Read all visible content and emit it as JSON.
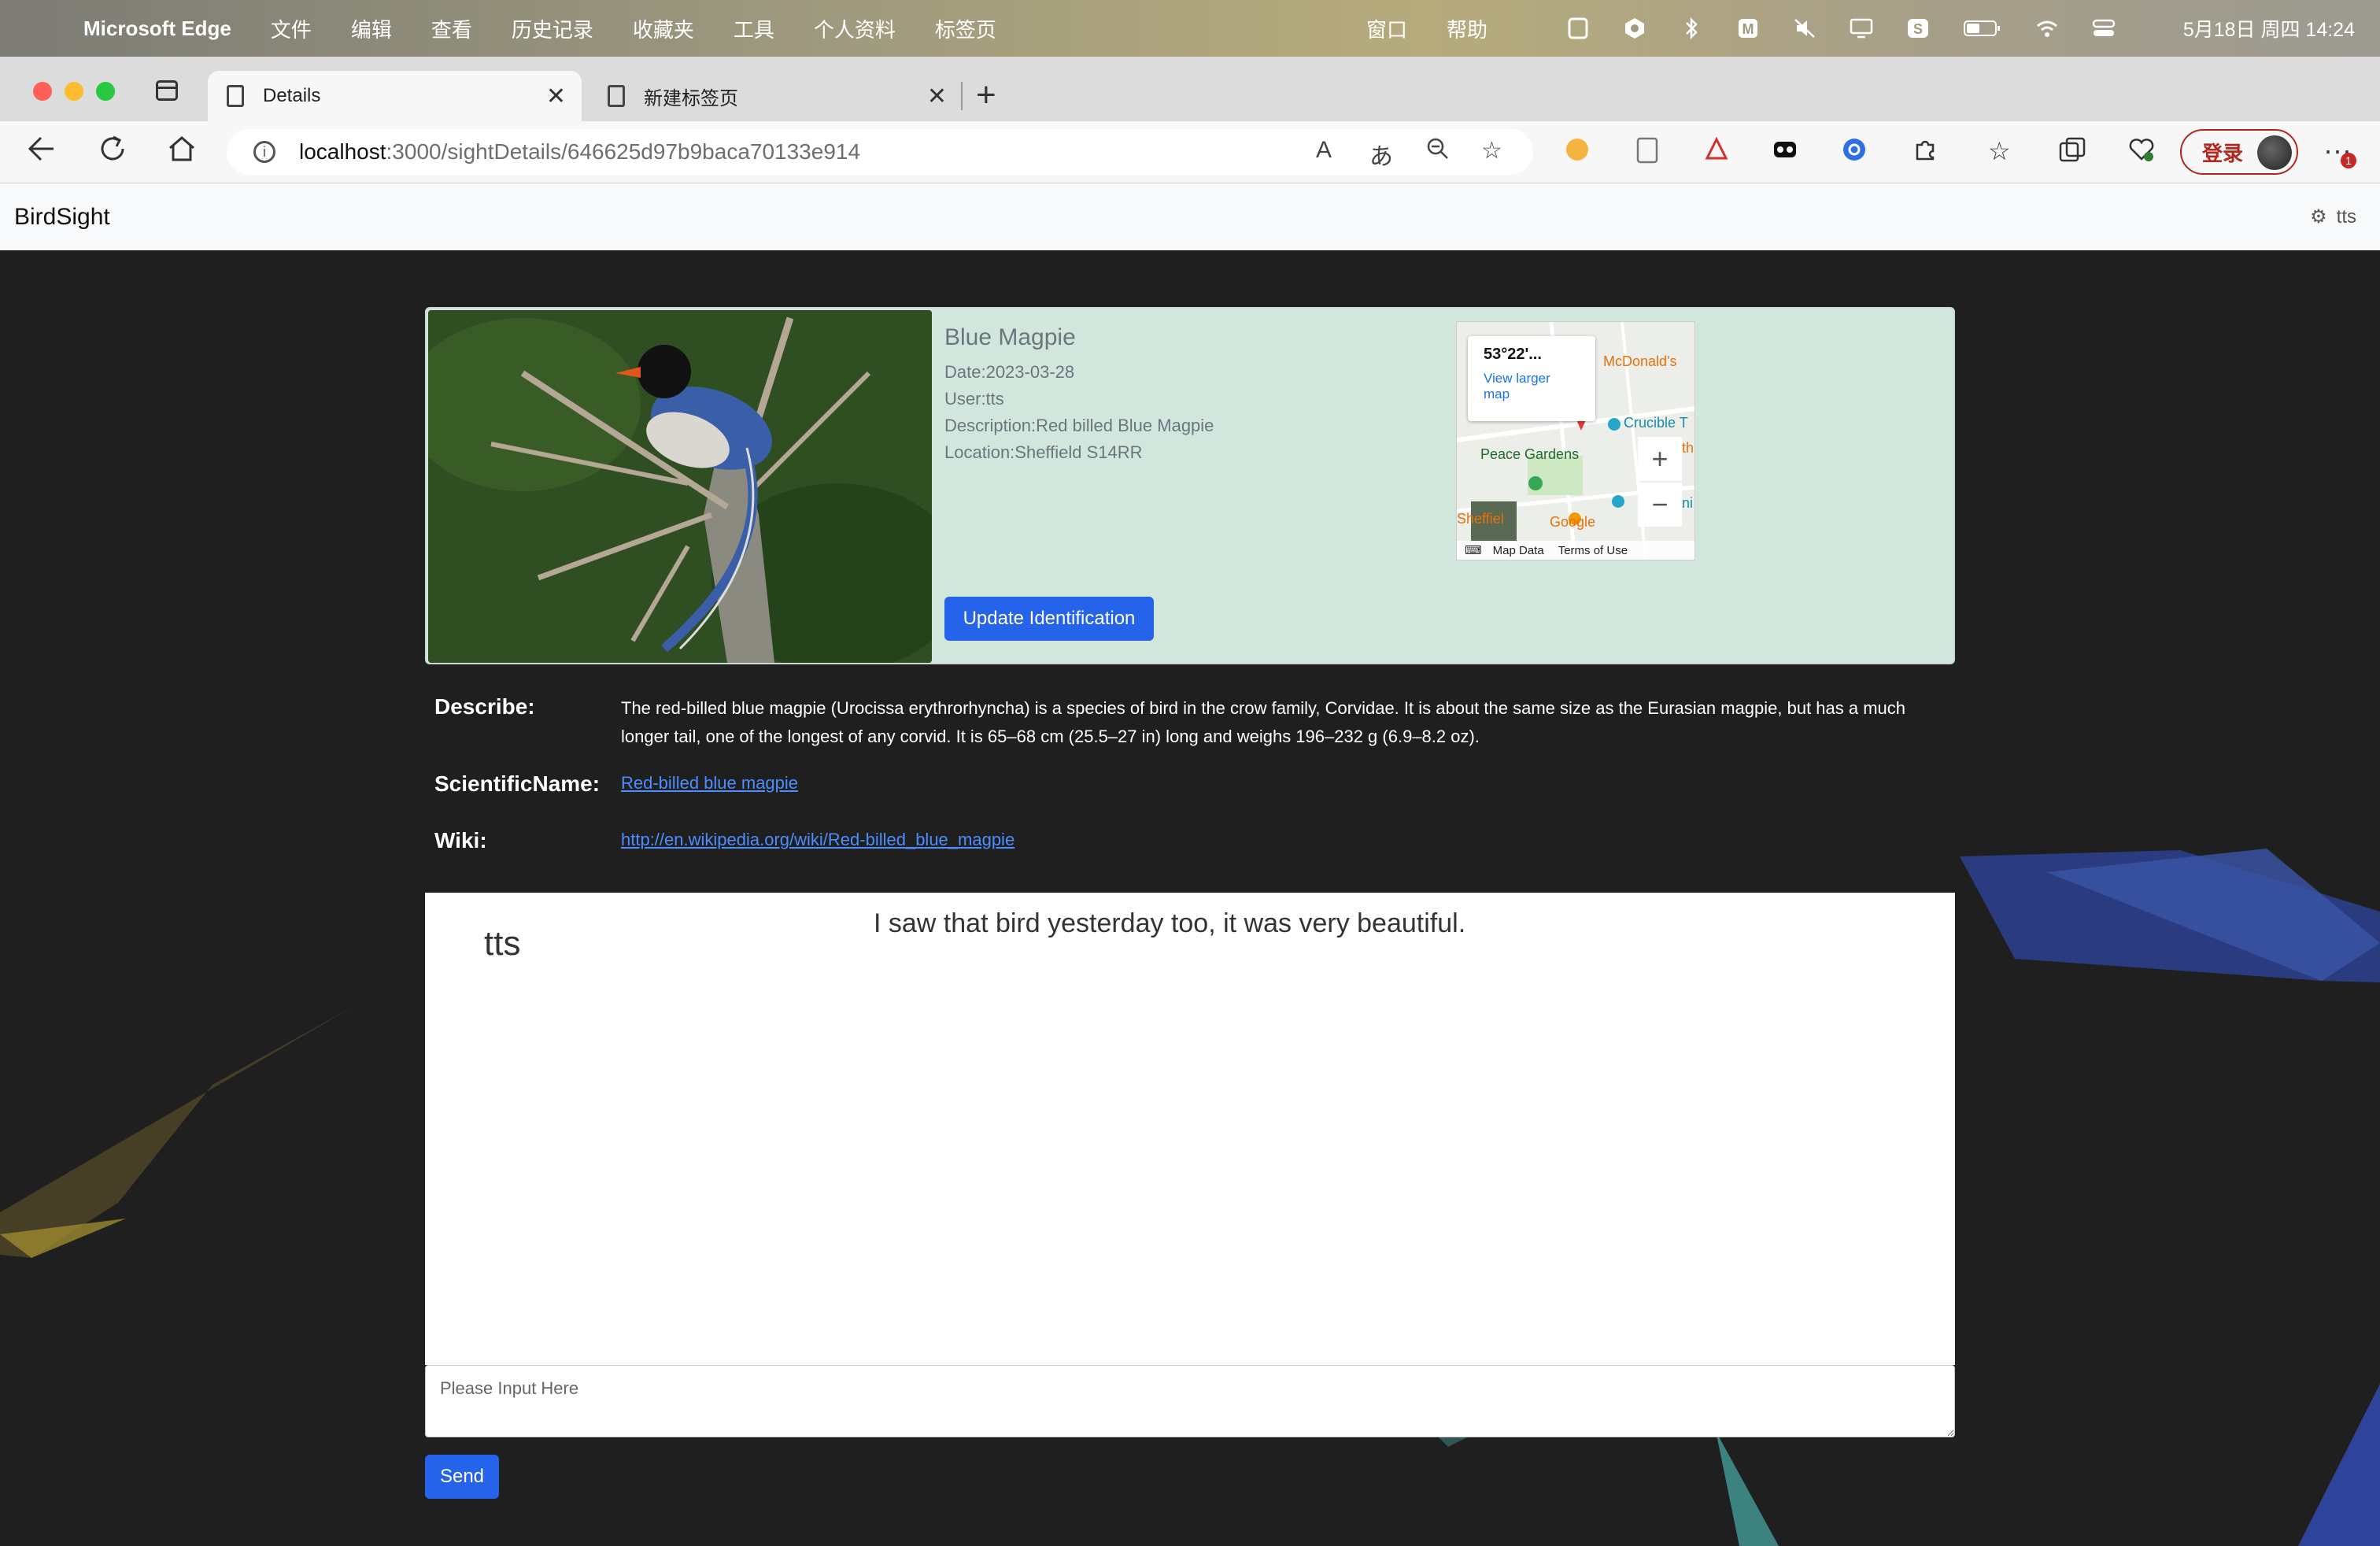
{
  "menubar": {
    "app_name": "Microsoft Edge",
    "menus": [
      "文件",
      "编辑",
      "查看",
      "历史记录",
      "收藏夹",
      "工具",
      "个人资料",
      "标签页"
    ],
    "right_menus": [
      "窗口",
      "帮助"
    ],
    "clock": "5月18日 周四  14:24"
  },
  "tabs": [
    {
      "title": "Details"
    },
    {
      "title": "新建标签页"
    }
  ],
  "address": {
    "host": "localhost",
    "path": ":3000/sightDetails/646625d97b9baca70133e914"
  },
  "toolbar": {
    "login_label": "登录",
    "more_badge": "1"
  },
  "navbar": {
    "brand": "BirdSight",
    "user": "tts"
  },
  "sighting": {
    "title": "Blue Magpie",
    "date": "Date:2023-03-28",
    "user": "User:tts",
    "description": "Description:Red billed Blue Magpie",
    "location": "Location:Sheffield S14RR",
    "update_button": "Update Identification"
  },
  "map": {
    "coords": "53°22'...",
    "view_larger": "View larger map",
    "labels": {
      "mcdonalds": "McDonald's",
      "crucible": "Crucible T",
      "peace_gardens": "Peace Gardens",
      "sheffield": "Sheffiel",
      "google": "Google",
      "edge_th": "th",
      "edge_ni": "ni"
    },
    "map_data": "Map Data",
    "terms": "Terms of Use",
    "zoom_in": "+",
    "zoom_out": "−"
  },
  "details": {
    "describe_label": "Describe:",
    "describe_text": "The red-billed blue magpie (Urocissa erythrorhyncha) is a species of bird in the crow family, Corvidae. It is about the same size as the Eurasian magpie, but has a much longer tail, one of the longest of any corvid. It is 65–68 cm (25.5–27 in) long and weighs 196–232 g (6.9–8.2 oz).",
    "scientific_label": "ScientificName:",
    "scientific_link": "Red-billed blue magpie",
    "wiki_label": "Wiki:",
    "wiki_link": "http://en.wikipedia.org/wiki/Red-billed_blue_magpie"
  },
  "chat": {
    "username": "tts",
    "message": "I saw that bird yesterday too, it was very beautiful.",
    "input_placeholder": "Please Input Here",
    "send_button": "Send"
  },
  "colors": {
    "card_bg": "#d1e7dd",
    "primary": "#2563eb",
    "page_bg": "#1f1f1f"
  }
}
